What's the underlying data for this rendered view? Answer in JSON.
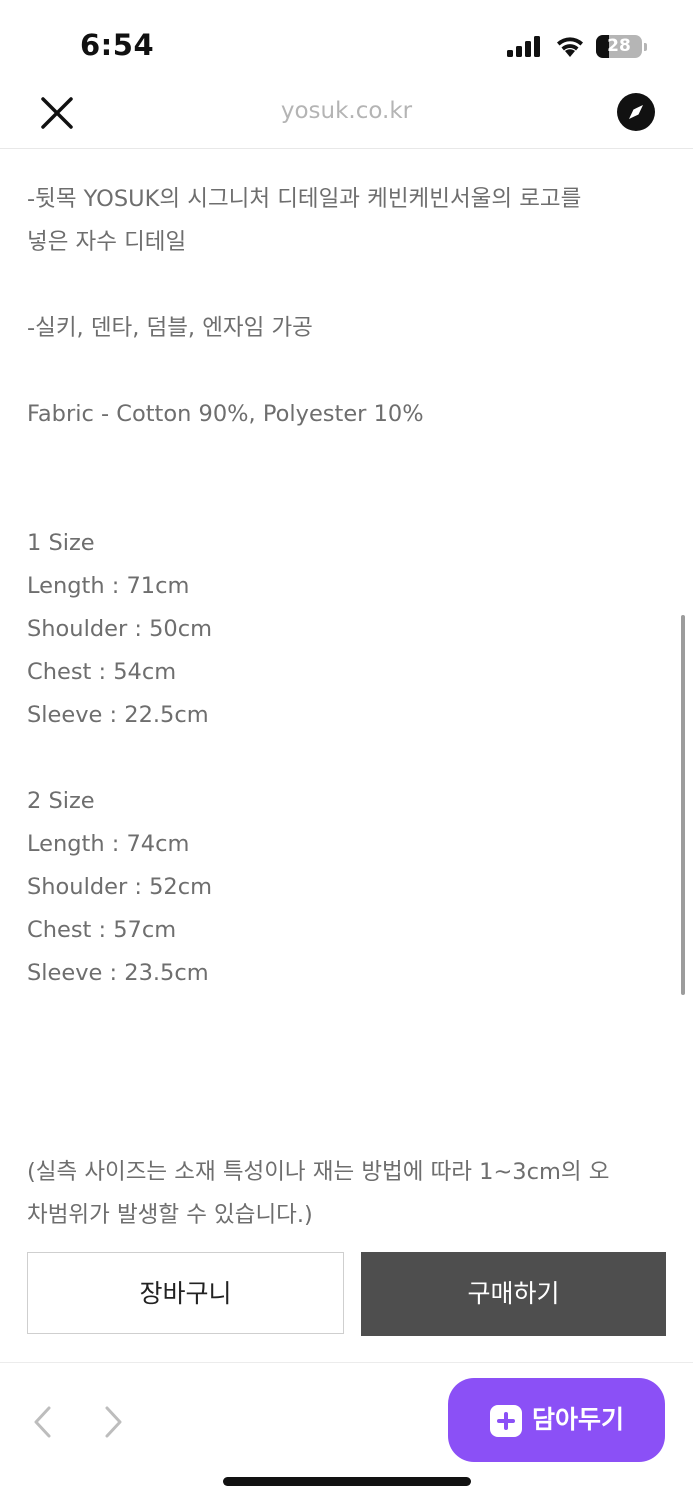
{
  "status_bar": {
    "time": "6:54",
    "battery_level": "28",
    "icons": [
      "signal-icon",
      "wifi-icon",
      "battery-icon"
    ]
  },
  "browser": {
    "url": "yosuk.co.kr",
    "icons": [
      "close-icon",
      "compass-icon"
    ]
  },
  "content": {
    "detail_line1": "-뒷목 YOSUK의 시그니처 디테일과 케빈케빈서울의 로고를",
    "detail_line2": "넣은 자수 디테일",
    "processing": "-실키, 덴타, 덤블, 엔자임 가공",
    "fabric": "Fabric - Cotton 90%, Polyester 10%",
    "sizes": [
      {
        "title": "1 Size",
        "length": "Length : 71cm",
        "shoulder": "Shoulder : 50cm",
        "chest": "Chest : 54cm",
        "sleeve": "Sleeve : 22.5cm"
      },
      {
        "title": "2 Size",
        "length": "Length : 74cm",
        "shoulder": "Shoulder : 52cm",
        "chest": "Chest : 57cm",
        "sleeve": "Sleeve : 23.5cm"
      }
    ],
    "note_line1": "(실측 사이즈는 소재 특성이나 재는 방법에 따라 1~3cm의 오",
    "note_line2": "차범위가 발생할 수 있습니다.)"
  },
  "purchase": {
    "cart_label": "장바구니",
    "buy_label": "구매하기"
  },
  "bottom_nav": {
    "save_label": "담아두기",
    "icons": [
      "chevron-left-icon",
      "chevron-right-icon",
      "plus-icon"
    ]
  },
  "colors": {
    "text": "#6e6e6e",
    "buy_button": "#4e4e4e",
    "save_button": "#8b50f6",
    "url_text": "#b4b4b4"
  }
}
